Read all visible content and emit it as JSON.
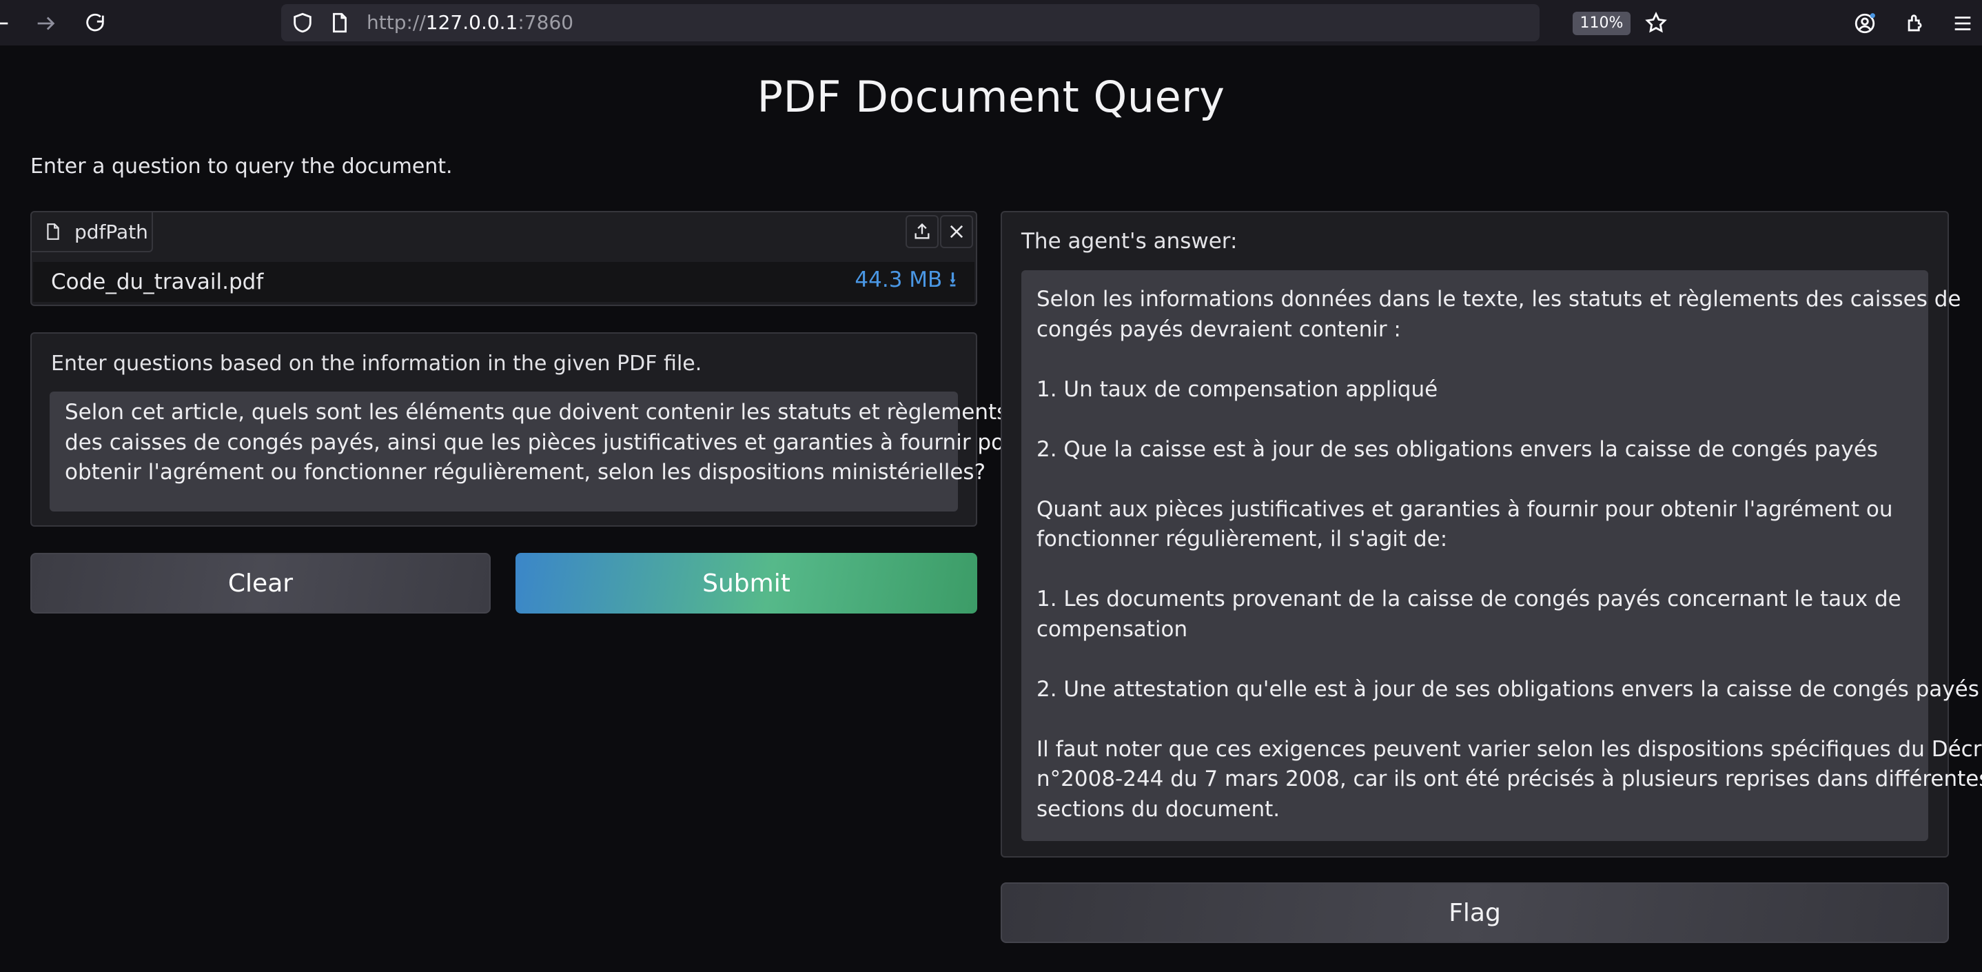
{
  "browser": {
    "url_prefix": "http://",
    "url_host": "127.0.0.1",
    "url_port": ":7860",
    "zoom": "110%"
  },
  "page": {
    "title": "PDF Document Query",
    "description": "Enter a question to query the document."
  },
  "file_input": {
    "label": "pdfPath",
    "file_name": "Code_du_travail.pdf",
    "file_size": "44.3 MB ⭳"
  },
  "question": {
    "label": "Enter questions based on the information in the given PDF file.",
    "lines": [
      "Selon cet article, quels sont les éléments que doivent contenir les statuts et règlements",
      "des caisses de congés payés, ainsi que les pièces justificatives et garanties à fournir pour",
      "obtenir l'agrément ou fonctionner régulièrement, selon les dispositions ministérielles?"
    ]
  },
  "buttons": {
    "clear": "Clear",
    "submit": "Submit",
    "flag": "Flag"
  },
  "answer": {
    "label": "The agent's answer:",
    "lines": [
      "Selon les informations données dans le texte, les statuts et règlements des caisses de",
      "congés payés devraient contenir :",
      "",
      "1. Un taux de compensation appliqué",
      "",
      "2. Que la caisse est à jour de ses obligations envers la caisse de congés payés",
      "",
      "Quant aux pièces justificatives et garanties à fournir pour obtenir l'agrément ou",
      "fonctionner régulièrement, il s'agit de:",
      "",
      "1. Les documents provenant de la caisse de congés payés concernant le taux de",
      "compensation",
      "",
      "2. Une attestation qu'elle est à jour de ses obligations envers la caisse de congés payés",
      "",
      "Il faut noter que ces exigences peuvent varier selon les dispositions spécifiques du Décret",
      "n°2008-244 du 7 mars 2008, car ils ont été précisés à plusieurs reprises dans différentes",
      "sections du document."
    ]
  }
}
